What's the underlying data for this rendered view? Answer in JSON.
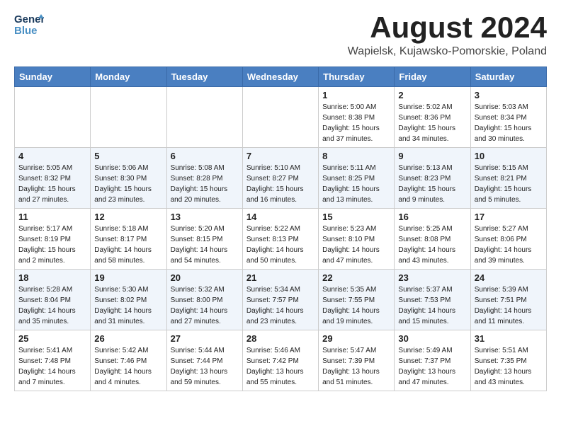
{
  "header": {
    "logo_general": "General",
    "logo_blue": "Blue",
    "month_title": "August 2024",
    "subtitle": "Wapielsk, Kujawsko-Pomorskie, Poland"
  },
  "days_of_week": [
    "Sunday",
    "Monday",
    "Tuesday",
    "Wednesday",
    "Thursday",
    "Friday",
    "Saturday"
  ],
  "weeks": [
    [
      {
        "day": "",
        "info": ""
      },
      {
        "day": "",
        "info": ""
      },
      {
        "day": "",
        "info": ""
      },
      {
        "day": "",
        "info": ""
      },
      {
        "day": "1",
        "info": "Sunrise: 5:00 AM\nSunset: 8:38 PM\nDaylight: 15 hours\nand 37 minutes."
      },
      {
        "day": "2",
        "info": "Sunrise: 5:02 AM\nSunset: 8:36 PM\nDaylight: 15 hours\nand 34 minutes."
      },
      {
        "day": "3",
        "info": "Sunrise: 5:03 AM\nSunset: 8:34 PM\nDaylight: 15 hours\nand 30 minutes."
      }
    ],
    [
      {
        "day": "4",
        "info": "Sunrise: 5:05 AM\nSunset: 8:32 PM\nDaylight: 15 hours\nand 27 minutes."
      },
      {
        "day": "5",
        "info": "Sunrise: 5:06 AM\nSunset: 8:30 PM\nDaylight: 15 hours\nand 23 minutes."
      },
      {
        "day": "6",
        "info": "Sunrise: 5:08 AM\nSunset: 8:28 PM\nDaylight: 15 hours\nand 20 minutes."
      },
      {
        "day": "7",
        "info": "Sunrise: 5:10 AM\nSunset: 8:27 PM\nDaylight: 15 hours\nand 16 minutes."
      },
      {
        "day": "8",
        "info": "Sunrise: 5:11 AM\nSunset: 8:25 PM\nDaylight: 15 hours\nand 13 minutes."
      },
      {
        "day": "9",
        "info": "Sunrise: 5:13 AM\nSunset: 8:23 PM\nDaylight: 15 hours\nand 9 minutes."
      },
      {
        "day": "10",
        "info": "Sunrise: 5:15 AM\nSunset: 8:21 PM\nDaylight: 15 hours\nand 5 minutes."
      }
    ],
    [
      {
        "day": "11",
        "info": "Sunrise: 5:17 AM\nSunset: 8:19 PM\nDaylight: 15 hours\nand 2 minutes."
      },
      {
        "day": "12",
        "info": "Sunrise: 5:18 AM\nSunset: 8:17 PM\nDaylight: 14 hours\nand 58 minutes."
      },
      {
        "day": "13",
        "info": "Sunrise: 5:20 AM\nSunset: 8:15 PM\nDaylight: 14 hours\nand 54 minutes."
      },
      {
        "day": "14",
        "info": "Sunrise: 5:22 AM\nSunset: 8:13 PM\nDaylight: 14 hours\nand 50 minutes."
      },
      {
        "day": "15",
        "info": "Sunrise: 5:23 AM\nSunset: 8:10 PM\nDaylight: 14 hours\nand 47 minutes."
      },
      {
        "day": "16",
        "info": "Sunrise: 5:25 AM\nSunset: 8:08 PM\nDaylight: 14 hours\nand 43 minutes."
      },
      {
        "day": "17",
        "info": "Sunrise: 5:27 AM\nSunset: 8:06 PM\nDaylight: 14 hours\nand 39 minutes."
      }
    ],
    [
      {
        "day": "18",
        "info": "Sunrise: 5:28 AM\nSunset: 8:04 PM\nDaylight: 14 hours\nand 35 minutes."
      },
      {
        "day": "19",
        "info": "Sunrise: 5:30 AM\nSunset: 8:02 PM\nDaylight: 14 hours\nand 31 minutes."
      },
      {
        "day": "20",
        "info": "Sunrise: 5:32 AM\nSunset: 8:00 PM\nDaylight: 14 hours\nand 27 minutes."
      },
      {
        "day": "21",
        "info": "Sunrise: 5:34 AM\nSunset: 7:57 PM\nDaylight: 14 hours\nand 23 minutes."
      },
      {
        "day": "22",
        "info": "Sunrise: 5:35 AM\nSunset: 7:55 PM\nDaylight: 14 hours\nand 19 minutes."
      },
      {
        "day": "23",
        "info": "Sunrise: 5:37 AM\nSunset: 7:53 PM\nDaylight: 14 hours\nand 15 minutes."
      },
      {
        "day": "24",
        "info": "Sunrise: 5:39 AM\nSunset: 7:51 PM\nDaylight: 14 hours\nand 11 minutes."
      }
    ],
    [
      {
        "day": "25",
        "info": "Sunrise: 5:41 AM\nSunset: 7:48 PM\nDaylight: 14 hours\nand 7 minutes."
      },
      {
        "day": "26",
        "info": "Sunrise: 5:42 AM\nSunset: 7:46 PM\nDaylight: 14 hours\nand 4 minutes."
      },
      {
        "day": "27",
        "info": "Sunrise: 5:44 AM\nSunset: 7:44 PM\nDaylight: 13 hours\nand 59 minutes."
      },
      {
        "day": "28",
        "info": "Sunrise: 5:46 AM\nSunset: 7:42 PM\nDaylight: 13 hours\nand 55 minutes."
      },
      {
        "day": "29",
        "info": "Sunrise: 5:47 AM\nSunset: 7:39 PM\nDaylight: 13 hours\nand 51 minutes."
      },
      {
        "day": "30",
        "info": "Sunrise: 5:49 AM\nSunset: 7:37 PM\nDaylight: 13 hours\nand 47 minutes."
      },
      {
        "day": "31",
        "info": "Sunrise: 5:51 AM\nSunset: 7:35 PM\nDaylight: 13 hours\nand 43 minutes."
      }
    ]
  ]
}
